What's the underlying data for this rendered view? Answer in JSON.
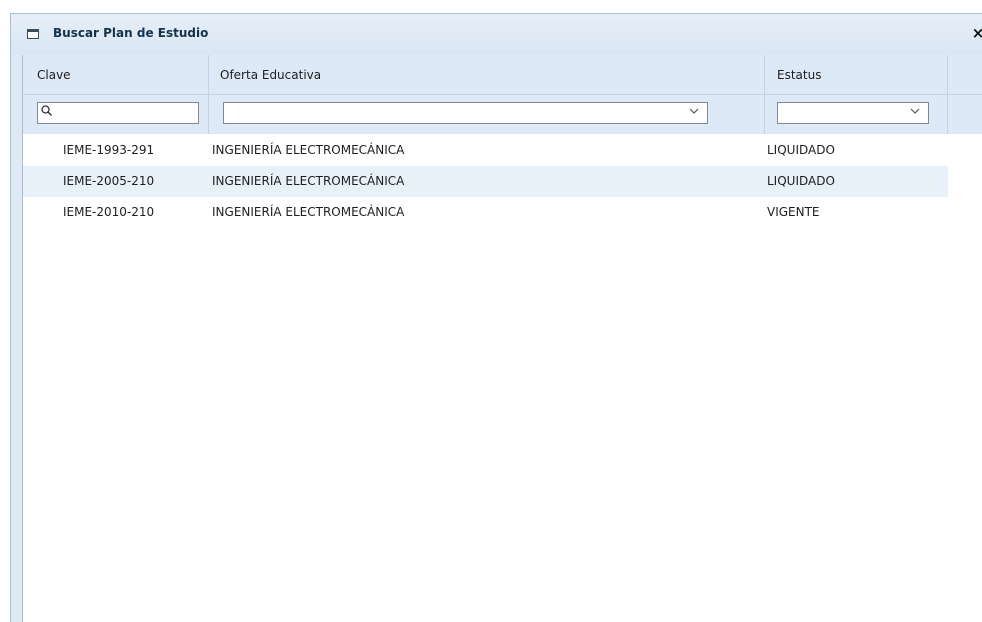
{
  "window": {
    "title": "Buscar Plan de Estudio",
    "close_label": "×"
  },
  "grid": {
    "columns": [
      {
        "key": "clave",
        "label": "Clave"
      },
      {
        "key": "oferta",
        "label": "Oferta Educativa"
      },
      {
        "key": "estatus",
        "label": "Estatus"
      }
    ],
    "filters": {
      "clave": {
        "value": "",
        "placeholder": ""
      },
      "oferta": {
        "value": ""
      },
      "estatus": {
        "value": ""
      }
    },
    "rows": [
      {
        "clave": "IEME-1993-291",
        "oferta": "INGENIERÍA ELECTROMECÁNICA",
        "estatus": "LIQUIDADO"
      },
      {
        "clave": "IEME-2005-210",
        "oferta": "INGENIERÍA ELECTROMECÁNICA",
        "estatus": "LIQUIDADO"
      },
      {
        "clave": "IEME-2010-210",
        "oferta": "INGENIERÍA ELECTROMECÁNICA",
        "estatus": "VIGENTE"
      }
    ]
  },
  "colors": {
    "header_bg": "#dde9f7",
    "alt_row_bg": "#e8f0fa",
    "border": "#a9bfd6"
  }
}
